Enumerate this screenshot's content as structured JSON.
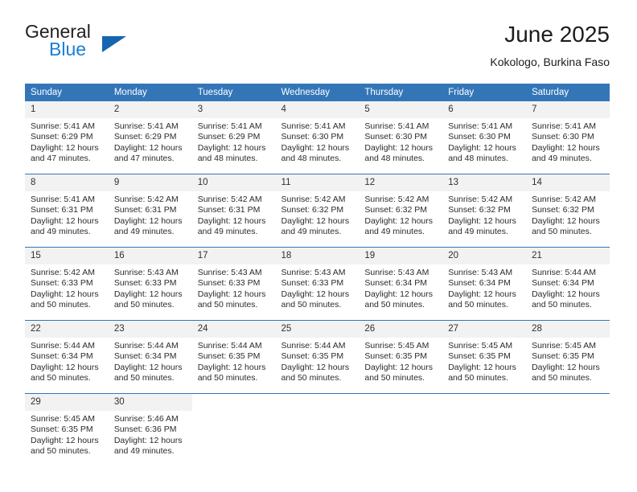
{
  "brand": {
    "name_part1": "General",
    "name_part2": "Blue",
    "logo_icon": "triangle-icon",
    "accent_color": "#1565b0"
  },
  "header": {
    "title": "June 2025",
    "subtitle": "Kokologo, Burkina Faso"
  },
  "theme": {
    "header_blue": "#3376b8",
    "daynum_gray": "#f2f2f2",
    "text": "#2b2b2b"
  },
  "calendar": {
    "weekdays": [
      "Sunday",
      "Monday",
      "Tuesday",
      "Wednesday",
      "Thursday",
      "Friday",
      "Saturday"
    ],
    "weeks": [
      [
        {
          "day": "1",
          "details": "Sunrise: 5:41 AM\nSunset: 6:29 PM\nDaylight: 12 hours and 47 minutes."
        },
        {
          "day": "2",
          "details": "Sunrise: 5:41 AM\nSunset: 6:29 PM\nDaylight: 12 hours and 47 minutes."
        },
        {
          "day": "3",
          "details": "Sunrise: 5:41 AM\nSunset: 6:29 PM\nDaylight: 12 hours and 48 minutes."
        },
        {
          "day": "4",
          "details": "Sunrise: 5:41 AM\nSunset: 6:30 PM\nDaylight: 12 hours and 48 minutes."
        },
        {
          "day": "5",
          "details": "Sunrise: 5:41 AM\nSunset: 6:30 PM\nDaylight: 12 hours and 48 minutes."
        },
        {
          "day": "6",
          "details": "Sunrise: 5:41 AM\nSunset: 6:30 PM\nDaylight: 12 hours and 48 minutes."
        },
        {
          "day": "7",
          "details": "Sunrise: 5:41 AM\nSunset: 6:30 PM\nDaylight: 12 hours and 49 minutes."
        }
      ],
      [
        {
          "day": "8",
          "details": "Sunrise: 5:41 AM\nSunset: 6:31 PM\nDaylight: 12 hours and 49 minutes."
        },
        {
          "day": "9",
          "details": "Sunrise: 5:42 AM\nSunset: 6:31 PM\nDaylight: 12 hours and 49 minutes."
        },
        {
          "day": "10",
          "details": "Sunrise: 5:42 AM\nSunset: 6:31 PM\nDaylight: 12 hours and 49 minutes."
        },
        {
          "day": "11",
          "details": "Sunrise: 5:42 AM\nSunset: 6:32 PM\nDaylight: 12 hours and 49 minutes."
        },
        {
          "day": "12",
          "details": "Sunrise: 5:42 AM\nSunset: 6:32 PM\nDaylight: 12 hours and 49 minutes."
        },
        {
          "day": "13",
          "details": "Sunrise: 5:42 AM\nSunset: 6:32 PM\nDaylight: 12 hours and 49 minutes."
        },
        {
          "day": "14",
          "details": "Sunrise: 5:42 AM\nSunset: 6:32 PM\nDaylight: 12 hours and 50 minutes."
        }
      ],
      [
        {
          "day": "15",
          "details": "Sunrise: 5:42 AM\nSunset: 6:33 PM\nDaylight: 12 hours and 50 minutes."
        },
        {
          "day": "16",
          "details": "Sunrise: 5:43 AM\nSunset: 6:33 PM\nDaylight: 12 hours and 50 minutes."
        },
        {
          "day": "17",
          "details": "Sunrise: 5:43 AM\nSunset: 6:33 PM\nDaylight: 12 hours and 50 minutes."
        },
        {
          "day": "18",
          "details": "Sunrise: 5:43 AM\nSunset: 6:33 PM\nDaylight: 12 hours and 50 minutes."
        },
        {
          "day": "19",
          "details": "Sunrise: 5:43 AM\nSunset: 6:34 PM\nDaylight: 12 hours and 50 minutes."
        },
        {
          "day": "20",
          "details": "Sunrise: 5:43 AM\nSunset: 6:34 PM\nDaylight: 12 hours and 50 minutes."
        },
        {
          "day": "21",
          "details": "Sunrise: 5:44 AM\nSunset: 6:34 PM\nDaylight: 12 hours and 50 minutes."
        }
      ],
      [
        {
          "day": "22",
          "details": "Sunrise: 5:44 AM\nSunset: 6:34 PM\nDaylight: 12 hours and 50 minutes."
        },
        {
          "day": "23",
          "details": "Sunrise: 5:44 AM\nSunset: 6:34 PM\nDaylight: 12 hours and 50 minutes."
        },
        {
          "day": "24",
          "details": "Sunrise: 5:44 AM\nSunset: 6:35 PM\nDaylight: 12 hours and 50 minutes."
        },
        {
          "day": "25",
          "details": "Sunrise: 5:44 AM\nSunset: 6:35 PM\nDaylight: 12 hours and 50 minutes."
        },
        {
          "day": "26",
          "details": "Sunrise: 5:45 AM\nSunset: 6:35 PM\nDaylight: 12 hours and 50 minutes."
        },
        {
          "day": "27",
          "details": "Sunrise: 5:45 AM\nSunset: 6:35 PM\nDaylight: 12 hours and 50 minutes."
        },
        {
          "day": "28",
          "details": "Sunrise: 5:45 AM\nSunset: 6:35 PM\nDaylight: 12 hours and 50 minutes."
        }
      ],
      [
        {
          "day": "29",
          "details": "Sunrise: 5:45 AM\nSunset: 6:35 PM\nDaylight: 12 hours and 50 minutes."
        },
        {
          "day": "30",
          "details": "Sunrise: 5:46 AM\nSunset: 6:36 PM\nDaylight: 12 hours and 49 minutes."
        },
        {
          "day": "",
          "details": ""
        },
        {
          "day": "",
          "details": ""
        },
        {
          "day": "",
          "details": ""
        },
        {
          "day": "",
          "details": ""
        },
        {
          "day": "",
          "details": ""
        }
      ]
    ]
  }
}
